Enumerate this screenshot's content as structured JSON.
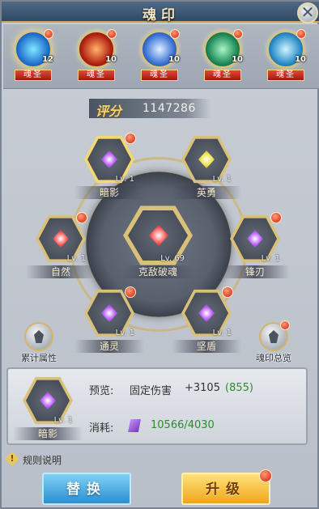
{
  "header": {
    "title": "魂印",
    "close_icon": "close-icon"
  },
  "slots": [
    {
      "level": "12",
      "tag": "魂圣",
      "badge": true
    },
    {
      "level": "10",
      "tag": "魂圣",
      "badge": true
    },
    {
      "level": "10",
      "tag": "魂圣",
      "badge": true
    },
    {
      "level": "10",
      "tag": "魂圣",
      "badge": true
    },
    {
      "level": "10",
      "tag": "魂圣",
      "badge": true
    }
  ],
  "score": {
    "label": "评分",
    "value": "1147286"
  },
  "gems": {
    "anying": {
      "name": "暗影",
      "level": "Lv. 1",
      "badge": true,
      "selected": true
    },
    "yingyong": {
      "name": "英勇",
      "level": "Lv. 1",
      "badge": false
    },
    "ziran": {
      "name": "自然",
      "level": "Lv. 1",
      "badge": true
    },
    "center": {
      "name": "克敌破魂",
      "level": "Lv. 69",
      "badge": false
    },
    "fengren": {
      "name": "锋刃",
      "level": "Lv. 1",
      "badge": true
    },
    "tongling": {
      "name": "通灵",
      "level": "Lv. 1",
      "badge": true
    },
    "jiandun": {
      "name": "坚盾",
      "level": "Lv. 1",
      "badge": true
    }
  },
  "side": {
    "left_label": "累计属性",
    "right_label": "魂印总览"
  },
  "info": {
    "gem_name": "暗影",
    "gem_level": "Lv. 1",
    "preview_label": "预览:",
    "preview_text": "固定伤害",
    "preview_value": "+3105",
    "preview_bonus": "(855)",
    "cost_label": "消耗:",
    "cost_value": "10566/4030"
  },
  "rules": {
    "label": "规则说明"
  },
  "buttons": {
    "swap": "替换",
    "upgrade": "升级"
  },
  "colors": {
    "accent_gold": "#d9c17a",
    "badge_red": "#d11c0a",
    "bonus_green": "#2e8a2e"
  }
}
